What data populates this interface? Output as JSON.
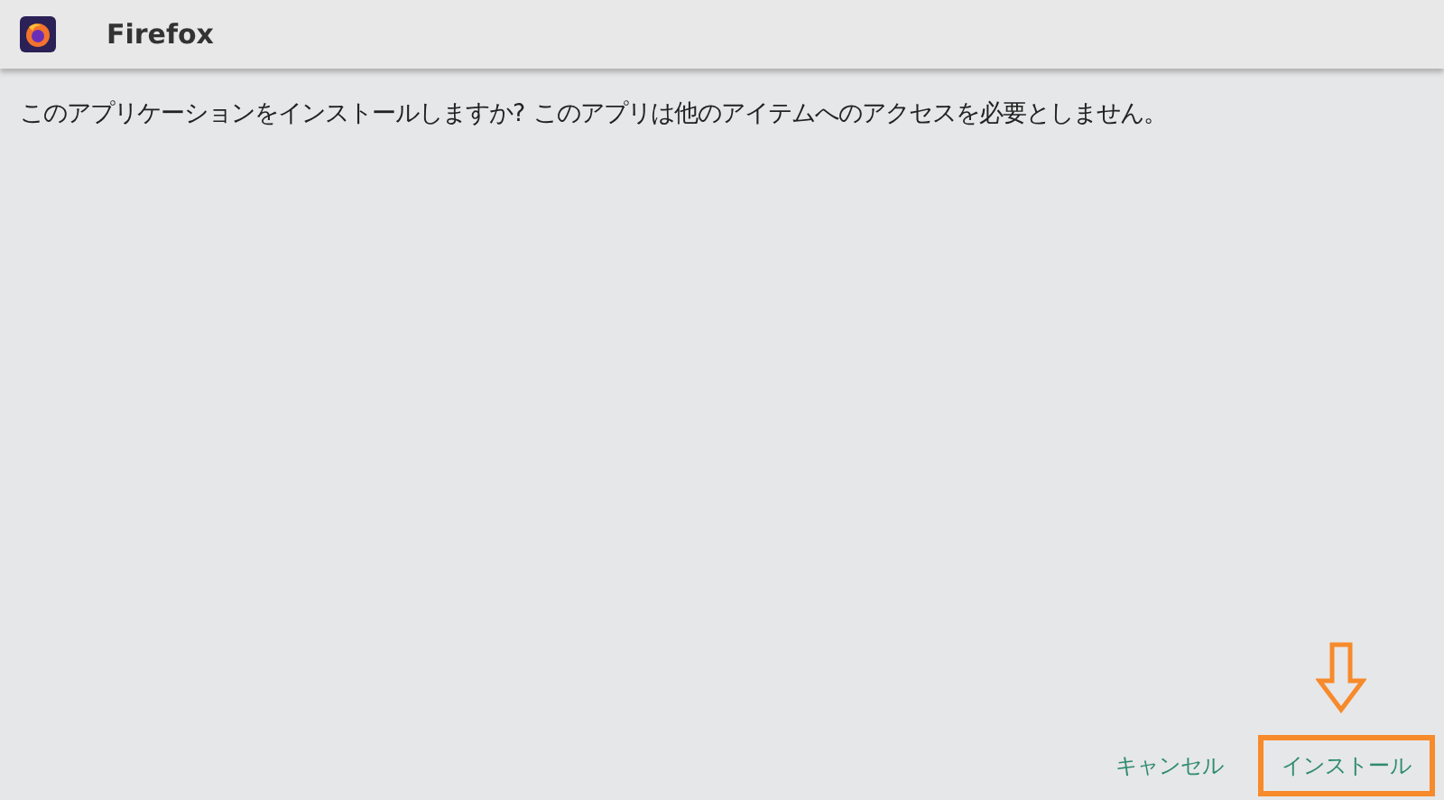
{
  "app_bar": {
    "title": "Firefox"
  },
  "message": "このアプリケーションをインストールしますか? このアプリは他のアイテムへのアクセスを必要としません。",
  "buttons": [
    {
      "label": "キャンセル",
      "highlighted": false
    },
    {
      "label": "インストール",
      "highlighted": true
    }
  ]
}
